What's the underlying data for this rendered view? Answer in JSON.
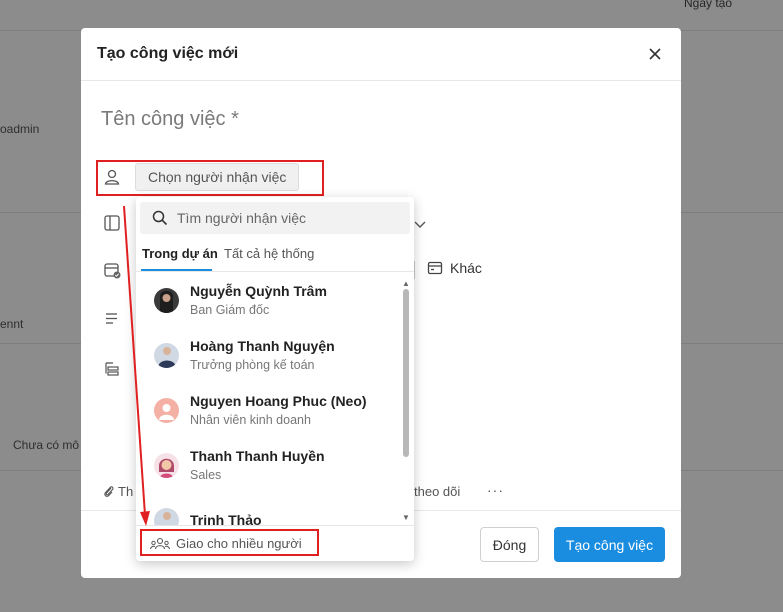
{
  "background": {
    "sort_label": "Ngày tạo",
    "row_texts": [
      "oadmin",
      "ennt",
      "Chưa có mô"
    ]
  },
  "modal": {
    "title": "Tạo công việc mới",
    "task_name_placeholder": "Tên công việc *",
    "assignee_button": "Chọn người nhận việc",
    "other_label": "Khác",
    "attach_fragment": "Th",
    "follow_fragment": "theo dõi",
    "more": "···",
    "close_button": "Đóng",
    "create_button": "Tạo công việc"
  },
  "dropdown": {
    "search_placeholder": "Tìm người nhận việc",
    "tabs": [
      {
        "label": "Trong dự án",
        "active": true
      },
      {
        "label": "Tất cả hệ thống",
        "active": false
      }
    ],
    "users": [
      {
        "name": "Nguyễn Quỳnh Trâm",
        "role": "Ban Giám đốc",
        "avatar": "photo-dark"
      },
      {
        "name": "Hoàng Thanh Nguyện",
        "role": "Trưởng phòng kế toán",
        "avatar": "photo-suit"
      },
      {
        "name": "Nguyen Hoang Phuc (Neo)",
        "role": "Nhân viên kinh doanh",
        "avatar": "placeholder-pink"
      },
      {
        "name": "Thanh Thanh Huyền",
        "role": "Sales",
        "avatar": "cartoon-woman"
      },
      {
        "name": "Trịnh Thảo",
        "role": "",
        "avatar": "photo-suit"
      }
    ],
    "multi_assign_label": "Giao cho nhiều người"
  },
  "colors": {
    "primary": "#1a8de0",
    "highlight": "#e02020"
  }
}
